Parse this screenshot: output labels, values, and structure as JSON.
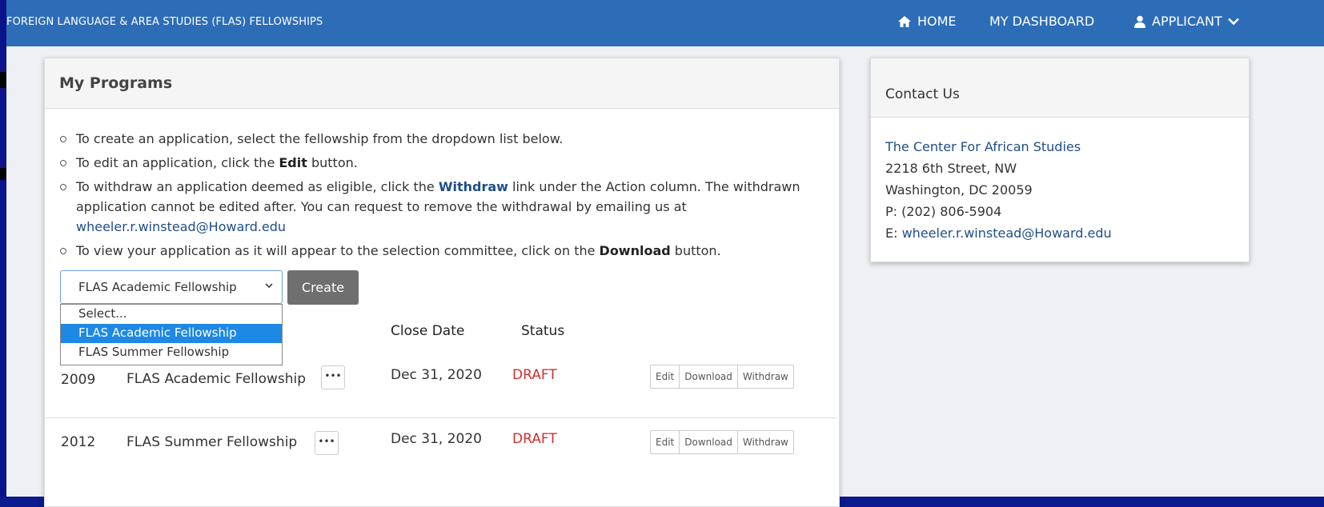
{
  "navbar": {
    "brand": "FOREIGN LANGUAGE & AREA STUDIES (FLAS) FELLOWSHIPS",
    "home": "HOME",
    "dashboard": "MY DASHBOARD",
    "applicant": "APPLICANT",
    "bg_color": "#2d6db8"
  },
  "programs": {
    "title": "My Programs",
    "instructions": {
      "i1": "To create an application, select the fellowship from the dropdown list below.",
      "i2_pre": "To edit an application, click the ",
      "i2_bold": "Edit",
      "i2_post": " button.",
      "i3_pre": "To withdraw an application deemed as eligible, click the ",
      "i3_bold": "Withdraw",
      "i3_mid": " link under the Action column. The withdrawn application cannot be edited after. You can request to remove the withdrawal by emailing us at ",
      "i3_email": "wheeler.r.winstead@Howard.edu",
      "i4_pre": "To view your application as it will appear to the selection committee, click on the ",
      "i4_bold": "Download",
      "i4_post": " button."
    },
    "select": {
      "selected": "FLAS Academic Fellowship",
      "options": [
        "Select...",
        "FLAS Academic Fellowship",
        "FLAS Summer Fellowship"
      ]
    },
    "create_label": "Create",
    "columns": {
      "close_date": "Close Date",
      "status": "Status"
    },
    "rows": [
      {
        "year": "2009",
        "name": "FLAS Academic Fellowship",
        "more": "•••",
        "close": "Dec 31, 2020",
        "status": "DRAFT"
      },
      {
        "year": "2012",
        "name": "FLAS Summer Fellowship",
        "more": "•••",
        "close": "Dec 31, 2020",
        "status": "DRAFT"
      }
    ],
    "actions": {
      "edit": "Edit",
      "download": "Download",
      "withdraw": "Withdraw"
    },
    "status_color": "#d32f2f"
  },
  "contact": {
    "title": "Contact Us",
    "org": "The Center For African Studies",
    "address1": "2218 6th Street, NW",
    "address2": "Washington, DC 20059",
    "phone": "P: (202) 806-5904",
    "email_prefix": "E: ",
    "email": "wheeler.r.winstead@Howard.edu"
  }
}
